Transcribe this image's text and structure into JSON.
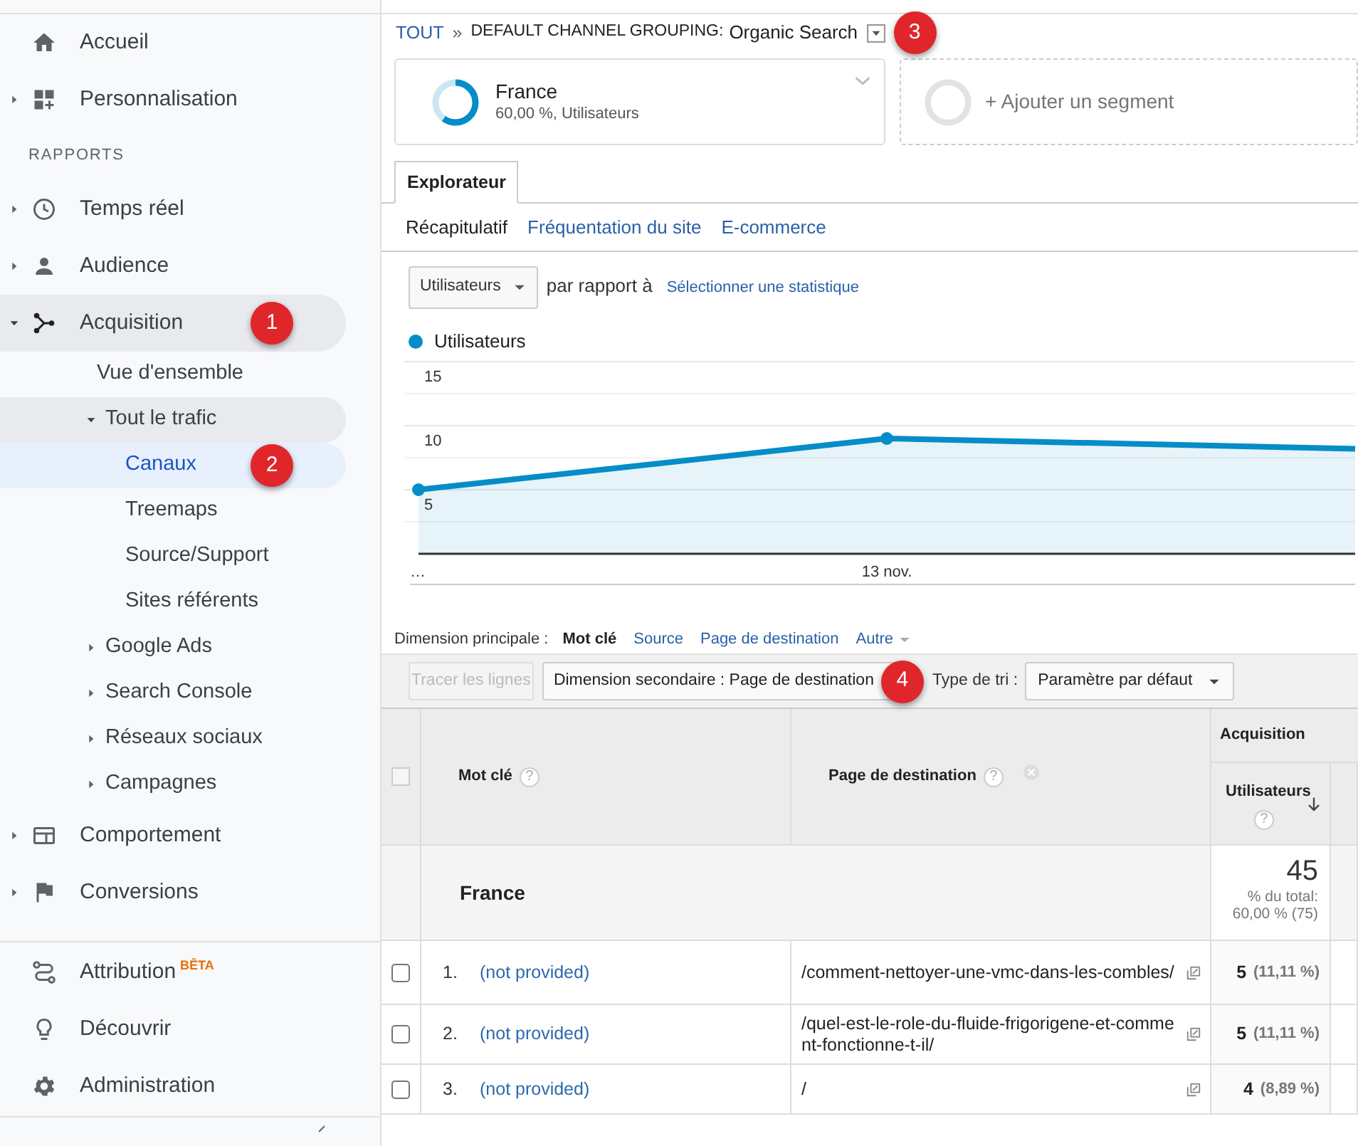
{
  "sidebar": {
    "top_items": [
      {
        "kind": "link",
        "label": "Accueil"
      },
      {
        "kind": "group",
        "label": "Personnalisation",
        "expanded": false
      }
    ],
    "section_title": "RAPPORTS",
    "report_items": [
      {
        "kind": "group",
        "label": "Temps réel",
        "expanded": false
      },
      {
        "kind": "group",
        "label": "Audience",
        "expanded": false
      },
      {
        "kind": "group",
        "label": "Acquisition",
        "expanded": true,
        "marker": "1",
        "children": [
          {
            "kind": "link",
            "label": "Vue d'ensemble",
            "selected": false
          },
          {
            "kind": "group",
            "label": "Tout le trafic",
            "expanded": true,
            "children": [
              {
                "kind": "link",
                "label": "Canaux",
                "selected": true,
                "marker": "2"
              },
              {
                "kind": "link",
                "label": "Treemaps",
                "selected": false
              },
              {
                "kind": "link",
                "label": "Source/Support",
                "selected": false
              },
              {
                "kind": "link",
                "label": "Sites référents",
                "selected": false
              }
            ]
          },
          {
            "kind": "group",
            "label": "Google Ads",
            "expanded": false
          },
          {
            "kind": "group",
            "label": "Search Console",
            "expanded": false
          },
          {
            "kind": "group",
            "label": "Réseaux sociaux",
            "expanded": false
          },
          {
            "kind": "group",
            "label": "Campagnes",
            "expanded": false
          }
        ]
      },
      {
        "kind": "group",
        "label": "Comportement",
        "expanded": false
      },
      {
        "kind": "group",
        "label": "Conversions",
        "expanded": false
      }
    ],
    "bottom_items": [
      {
        "kind": "link",
        "label": "Attribution",
        "badge": "BÊTA"
      },
      {
        "kind": "link",
        "label": "Découvrir"
      },
      {
        "kind": "link",
        "label": "Administration"
      }
    ]
  },
  "breadcrumb": {
    "root": "TOUT",
    "separator": "»",
    "prefix": "DEFAULT CHANNEL GROUPING:",
    "value": "Organic Search",
    "marker": "3"
  },
  "segments": {
    "active": {
      "name": "France",
      "detail": "60,00 %, Utilisateurs",
      "level": 0.6
    },
    "add_label": "+ Ajouter un segment"
  },
  "tabs": [
    {
      "label": "Explorateur",
      "selected": true
    }
  ],
  "subtabs": [
    {
      "label": "Récapitulatif",
      "selected": true
    },
    {
      "label": "Fréquentation du site",
      "selected": false
    },
    {
      "label": "E-commerce",
      "selected": false
    }
  ],
  "metric_picker": {
    "value": "Utilisateurs",
    "compare_label": "par rapport à",
    "select_link": "Sélectionner une statistique"
  },
  "chart": {
    "chart_data": {
      "type": "area",
      "categories": [
        "…",
        "13 nov.",
        null
      ],
      "ylim": [
        0,
        15
      ],
      "yticks": [
        5,
        10,
        15
      ],
      "series": [
        {
          "name": "Utilisateurs",
          "color": "#058dc7",
          "values": [
            5,
            9,
            8.2
          ]
        }
      ]
    }
  },
  "primary_dimension": {
    "label": "Dimension principale :",
    "options": [
      {
        "label": "Mot clé",
        "selected": true
      },
      {
        "label": "Source",
        "selected": false
      },
      {
        "label": "Page de destination",
        "selected": false
      },
      {
        "label": "Autre",
        "selected": false
      }
    ]
  },
  "toolbar": {
    "plot_button": {
      "label": "Tracer les lignes",
      "disabled": true
    },
    "secondary_dimension": "Dimension secondaire : Page de destination",
    "secondary_marker": "4",
    "sort_label": "Type de tri :",
    "sort_value": "Paramètre par défaut"
  },
  "table": {
    "group_header": "Acquisition",
    "select_all_checked": false,
    "columns": [
      {
        "label": "Mot clé",
        "help": "?"
      },
      {
        "label": "Page de destination",
        "help": "?"
      },
      {
        "label": "Utilisateurs",
        "help": "?"
      }
    ],
    "summary": {
      "label": "France",
      "value": "45",
      "share_label": "% du total:",
      "share_value": "60,00 % (75)"
    },
    "rows": [
      {
        "index": "1.",
        "keyword": "(not provided)",
        "page": "/comment-nettoyer-une-vmc-dans-les-combles/",
        "users": "5",
        "users_pct": "(11,11 %)",
        "checked": false
      },
      {
        "index": "2.",
        "keyword": "(not provided)",
        "page": "/quel-est-le-role-du-fluide-frigorigene-et-comment-fonctionne-t-il/",
        "users": "5",
        "users_pct": "(11,11 %)",
        "checked": false
      },
      {
        "index": "3.",
        "keyword": "(not provided)",
        "page": "/",
        "users": "4",
        "users_pct": "(8,89 %)",
        "checked": false
      }
    ]
  }
}
